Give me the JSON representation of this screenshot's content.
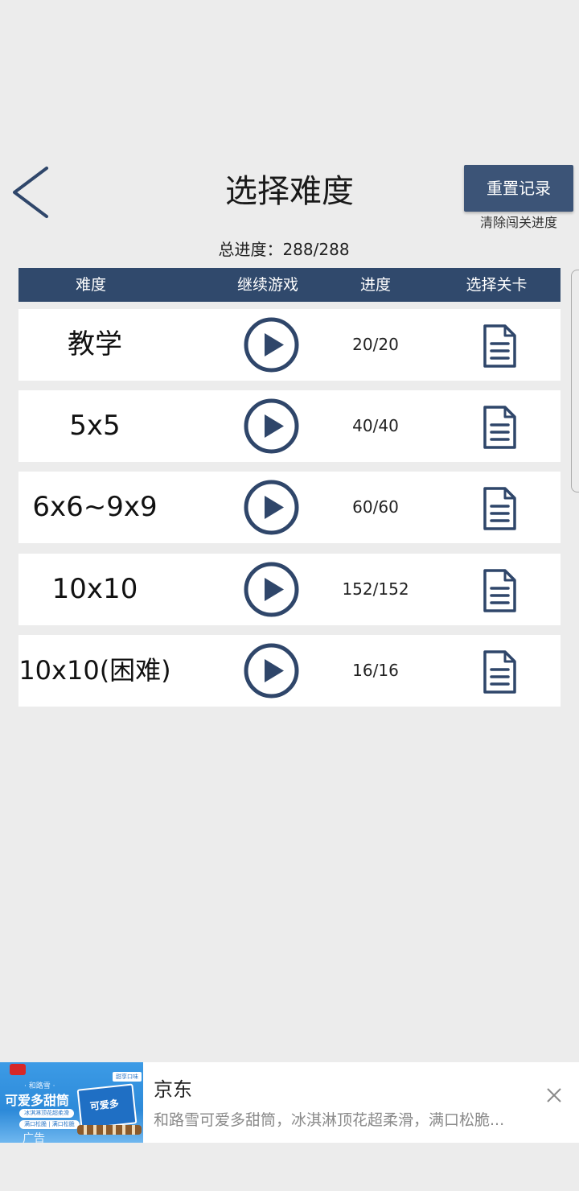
{
  "header": {
    "title": "选择难度",
    "reset_button_label": "重置记录",
    "reset_subtitle": "清除闯关进度",
    "total_progress": "总进度：288/288"
  },
  "table": {
    "columns": [
      "难度",
      "继续游戏",
      "进度",
      "选择关卡"
    ],
    "rows": [
      {
        "difficulty": "教学",
        "progress": "20/20"
      },
      {
        "difficulty": "5x5",
        "progress": "40/40"
      },
      {
        "difficulty": "6x6~9x9",
        "progress": "60/60"
      },
      {
        "difficulty": "10x10",
        "progress": "152/152"
      },
      {
        "difficulty": "10x10(困难)",
        "progress": "16/16"
      }
    ]
  },
  "ad": {
    "source": "京东",
    "text": "和路雪可爱多甜筒，冰淇淋顶花超柔滑，满口松脆...",
    "image_label": "广告",
    "image_top_line": "· 和路雪 ·",
    "image_headline": "可爱多甜筒",
    "image_pill_1": "冰淇淋顶花超柔滑",
    "image_pill_2": "满口松脆 | 满口松脆",
    "image_tag": "甜享口味",
    "image_box_title": "可爱多"
  },
  "icons": {
    "back": "chevron-left-icon",
    "play": "play-circle-icon",
    "document": "document-list-icon",
    "close": "close-icon"
  },
  "colors": {
    "background": "#ececec",
    "header_bar": "#30496c",
    "button": "#3c5477",
    "icon": "#2f466a"
  }
}
